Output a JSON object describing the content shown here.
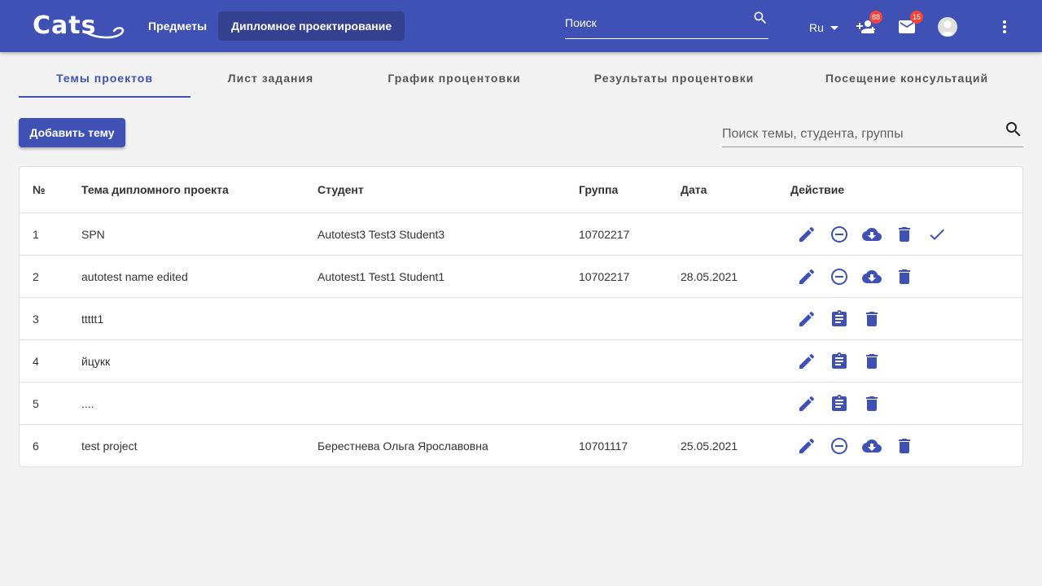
{
  "app": {
    "logo": "Cats",
    "nav": [
      "Предметы",
      "Дипломное проектирование"
    ],
    "search_placeholder": "Поиск",
    "language": "Ru",
    "notifications_count": "88",
    "messages_count": "15"
  },
  "tabs": [
    "Темы проектов",
    "Лист задания",
    "График процентовки",
    "Результаты процентовки",
    "Посещение консультаций"
  ],
  "toolbar": {
    "add_label": "Добавить тему",
    "filter_placeholder": "Поиск темы, студента, группы"
  },
  "table": {
    "headers": [
      "№",
      "Тема дипломного проекта",
      "Студент",
      "Группа",
      "Дата",
      "Действие"
    ],
    "rows": [
      {
        "num": "1",
        "topic": "SPN",
        "student": "Autotest3 Test3 Student3",
        "group": "10702217",
        "date": "",
        "actions": [
          "edit-icon",
          "remove-circle-icon",
          "cloud-download-icon",
          "delete-icon",
          "check-icon"
        ]
      },
      {
        "num": "2",
        "topic": "autotest name edited",
        "student": "Autotest1 Test1 Student1",
        "group": "10702217",
        "date": "28.05.2021",
        "actions": [
          "edit-icon",
          "remove-circle-icon",
          "cloud-download-icon",
          "delete-icon"
        ]
      },
      {
        "num": "3",
        "topic": "ttttt1",
        "student": "",
        "group": "",
        "date": "",
        "actions": [
          "edit-icon",
          "assignment-icon",
          "delete-icon"
        ]
      },
      {
        "num": "4",
        "topic": "йцукк",
        "student": "",
        "group": "",
        "date": "",
        "actions": [
          "edit-icon",
          "assignment-icon",
          "delete-icon"
        ]
      },
      {
        "num": "5",
        "topic": "....",
        "student": "",
        "group": "",
        "date": "",
        "actions": [
          "edit-icon",
          "assignment-icon",
          "delete-icon"
        ]
      },
      {
        "num": "6",
        "topic": "test project",
        "student": "Берестнева Ольга Ярославовна",
        "group": "10701117",
        "date": "25.05.2021",
        "actions": [
          "edit-icon",
          "remove-circle-icon",
          "cloud-download-icon",
          "delete-icon"
        ]
      }
    ]
  },
  "colors": {
    "primary": "#3f51b5",
    "nav_active": "#334190",
    "badge": "#f44336",
    "background": "#f3f3f3"
  }
}
